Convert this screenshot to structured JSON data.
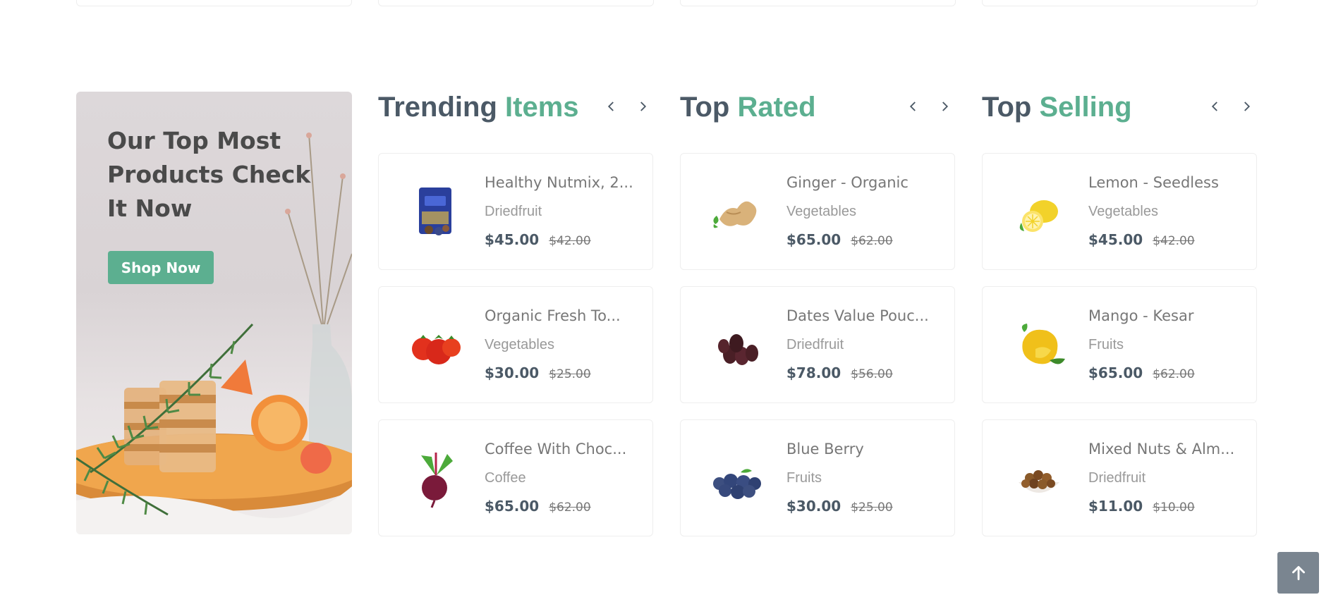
{
  "banner": {
    "title": "Our Top Most Products Check It Now",
    "button": "Shop Now"
  },
  "columns": [
    {
      "title_main": "Trending",
      "title_accent": "Items",
      "products": [
        {
          "name": "Healthy Nutmix, 2...",
          "category": "Driedfruit",
          "price": "$45.00",
          "old_price": "$42.00",
          "icon": "nutmix-pack-icon"
        },
        {
          "name": "Organic Fresh To...",
          "category": "Vegetables",
          "price": "$30.00",
          "old_price": "$25.00",
          "icon": "tomato-icon"
        },
        {
          "name": "Coffee With Choc...",
          "category": "Coffee",
          "price": "$65.00",
          "old_price": "$62.00",
          "icon": "beetroot-icon"
        }
      ]
    },
    {
      "title_main": "Top",
      "title_accent": "Rated",
      "products": [
        {
          "name": "Ginger - Organic",
          "category": "Vegetables",
          "price": "$65.00",
          "old_price": "$62.00",
          "icon": "ginger-icon"
        },
        {
          "name": "Dates Value Pouc...",
          "category": "Driedfruit",
          "price": "$78.00",
          "old_price": "$56.00",
          "icon": "dates-icon"
        },
        {
          "name": "Blue Berry",
          "category": "Fruits",
          "price": "$30.00",
          "old_price": "$25.00",
          "icon": "blueberry-icon"
        }
      ]
    },
    {
      "title_main": "Top",
      "title_accent": "Selling",
      "products": [
        {
          "name": "Lemon - Seedless",
          "category": "Vegetables",
          "price": "$45.00",
          "old_price": "$42.00",
          "icon": "lemon-icon"
        },
        {
          "name": "Mango - Kesar",
          "category": "Fruits",
          "price": "$65.00",
          "old_price": "$62.00",
          "icon": "mango-icon"
        },
        {
          "name": "Mixed Nuts & Alm...",
          "category": "Driedfruit",
          "price": "$11.00",
          "old_price": "$10.00",
          "icon": "mixed-nuts-icon"
        }
      ]
    }
  ],
  "colors": {
    "accent": "#5caf90",
    "heading": "#4b5966",
    "scroll_top": "#7a8590"
  }
}
